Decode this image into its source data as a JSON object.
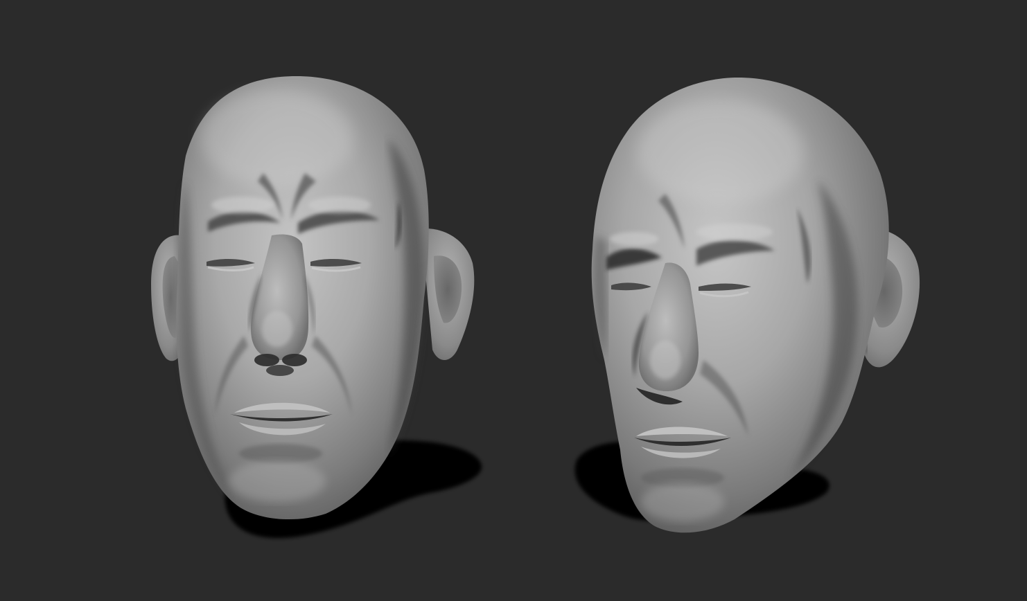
{
  "scene": {
    "background_color": "#2b2b2b",
    "clay_color": "#9a9a9a",
    "shadow_color": "#050505",
    "models": [
      {
        "view": "front"
      },
      {
        "view": "three-quarter"
      }
    ]
  }
}
